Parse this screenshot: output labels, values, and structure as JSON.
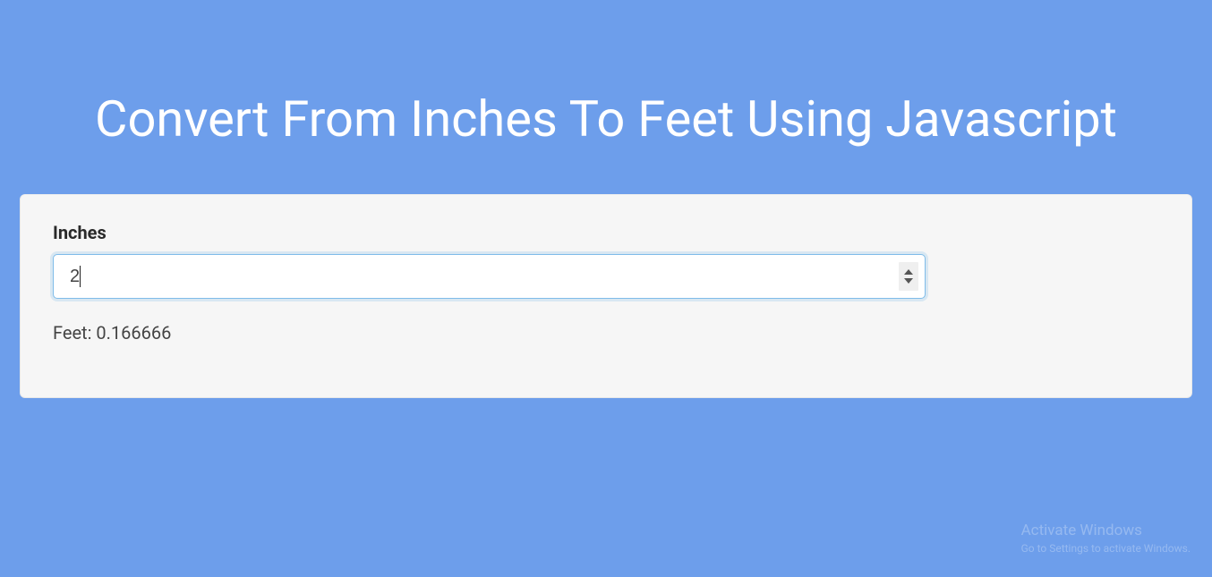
{
  "title": "Convert From Inches To Feet Using Javascript",
  "form": {
    "inches_label": "Inches",
    "inches_value": "2",
    "result_prefix": "Feet: ",
    "result_value": "0.166666"
  },
  "watermark": {
    "line1": "Activate Windows",
    "line2": "Go to Settings to activate Windows."
  }
}
